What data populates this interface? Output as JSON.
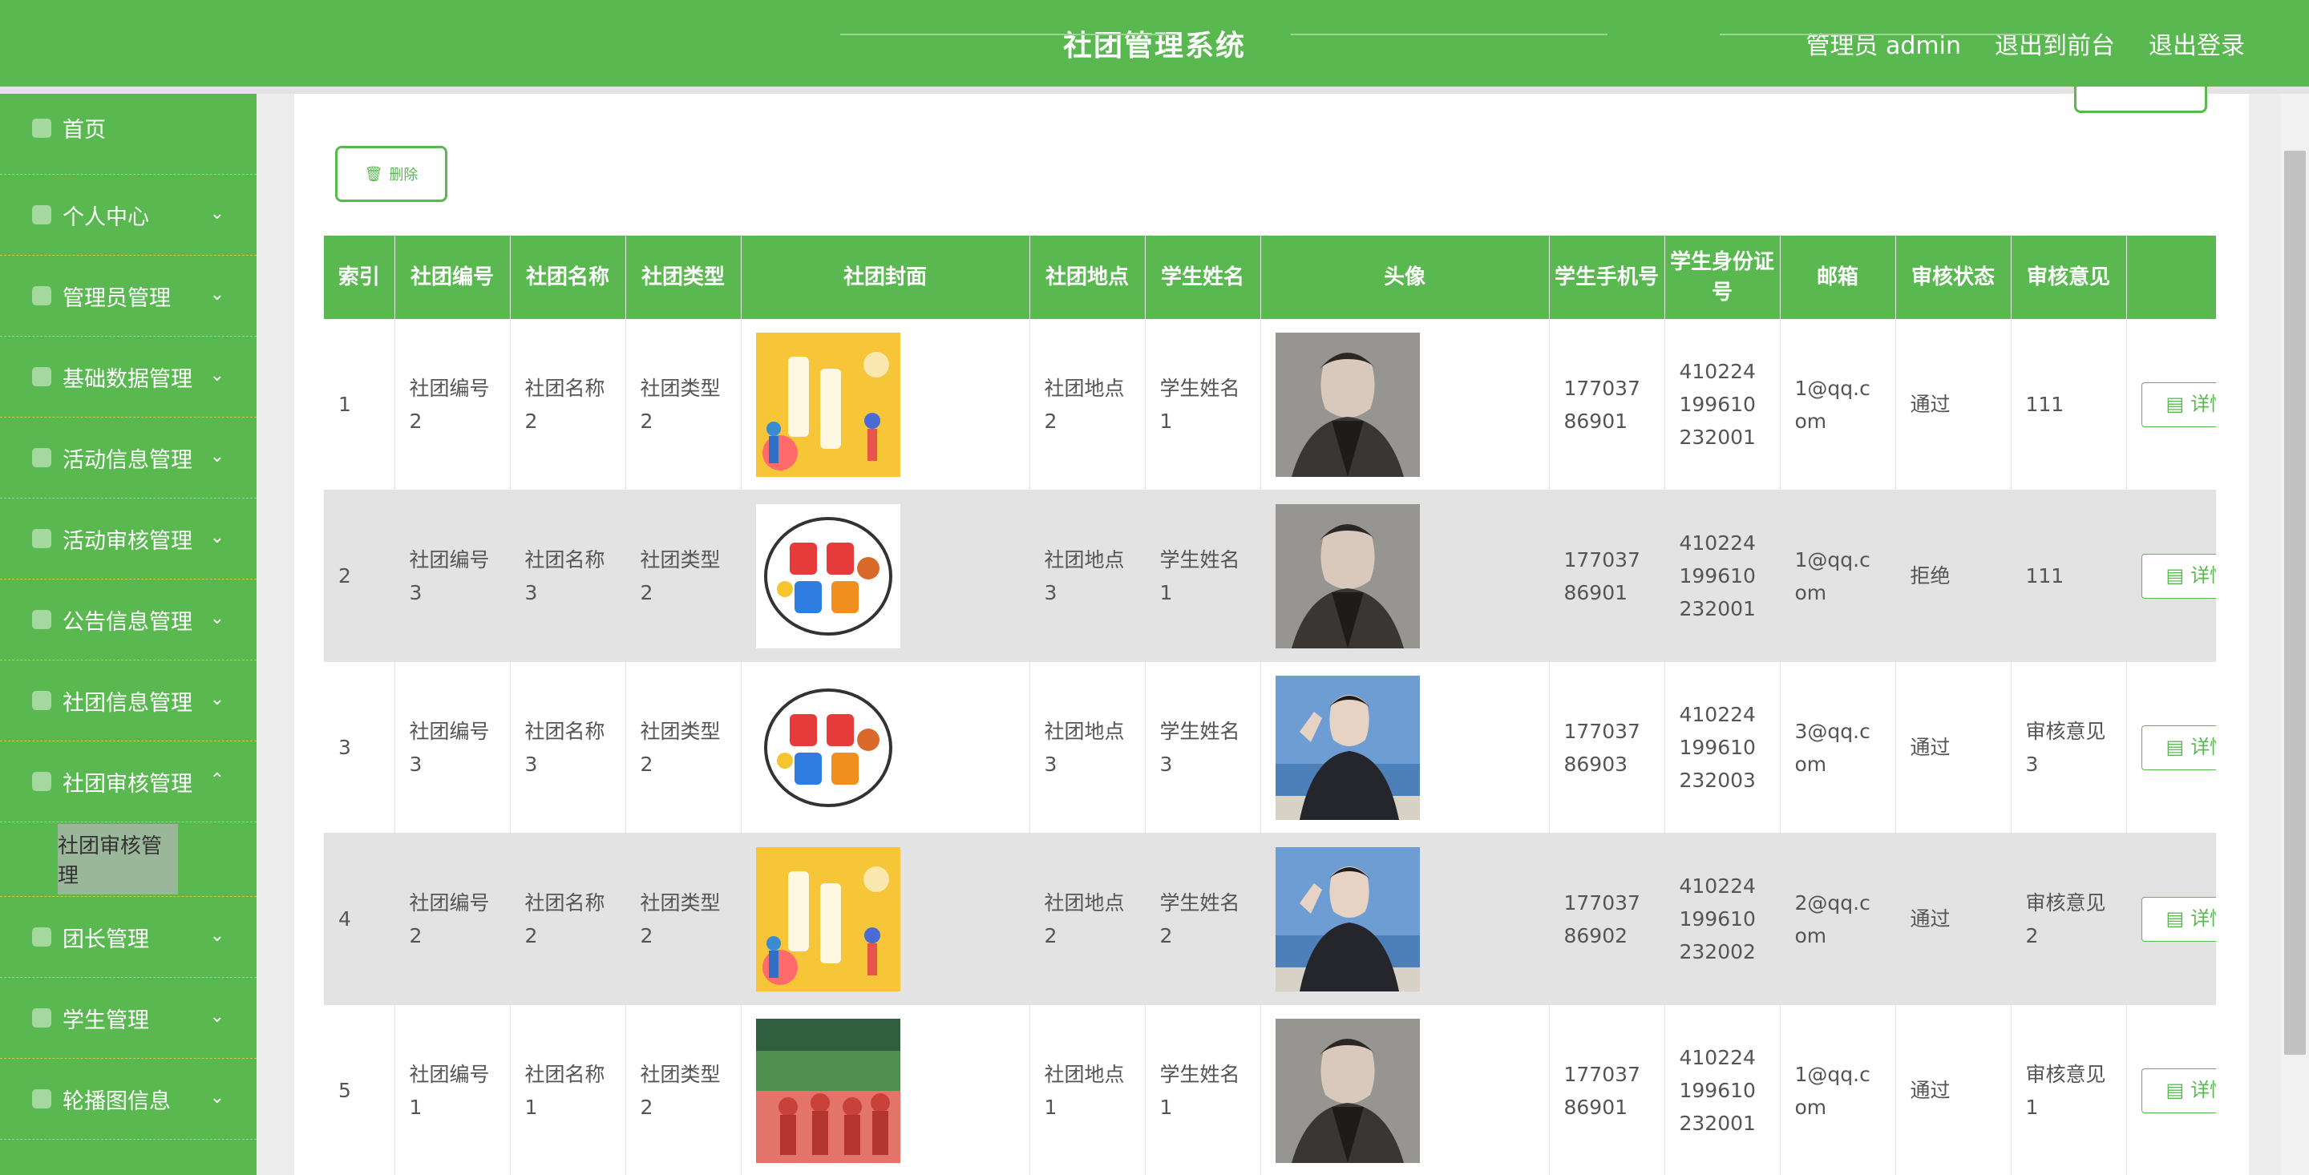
{
  "header": {
    "title": "社团管理系统",
    "user": "管理员 admin",
    "front_link": "退出到前台",
    "logout_link": "退出登录"
  },
  "sidebar": {
    "items": [
      {
        "label": "首页",
        "icon": "home-icon"
      },
      {
        "label": "个人中心",
        "icon": "user-icon",
        "expandable": true
      },
      {
        "label": "管理员管理",
        "icon": "admin-icon",
        "expandable": true
      },
      {
        "label": "基础数据管理",
        "icon": "database-icon",
        "expandable": true
      },
      {
        "label": "活动信息管理",
        "icon": "activity-icon",
        "expandable": true
      },
      {
        "label": "活动审核管理",
        "icon": "list-icon",
        "expandable": true
      },
      {
        "label": "公告信息管理",
        "icon": "notice-icon",
        "expandable": true
      },
      {
        "label": "社团信息管理",
        "icon": "clock-icon",
        "expandable": true
      },
      {
        "label": "社团审核管理",
        "icon": "chart-icon",
        "expandable": true,
        "expanded": true
      },
      {
        "label": "团长管理",
        "icon": "leader-icon",
        "expandable": true
      },
      {
        "label": "学生管理",
        "icon": "student-icon",
        "expandable": true
      },
      {
        "label": "轮播图信息",
        "icon": "carousel-icon",
        "expandable": true
      }
    ],
    "active_sub": "社团审核管理"
  },
  "toolbar": {
    "delete_label": "删除"
  },
  "table": {
    "headers": [
      "索引",
      "社团编号",
      "社团名称",
      "社团类型",
      "社团封面",
      "社团地点",
      "学生姓名",
      "头像",
      "学生手机号",
      "学生身份证号",
      "邮箱",
      "审核状态",
      "审核意见",
      ""
    ],
    "detail_label": "详情",
    "rows": [
      {
        "index": "1",
        "code": "社团编号2",
        "name": "社团名称2",
        "type": "社团类型2",
        "cover": "yellow-recruit",
        "place": "社团地点2",
        "student": "学生姓名1",
        "avatar": "avatar-a",
        "phone": "17703786901",
        "id_card": "410224199610232001",
        "email": "1@qq.com",
        "status": "通过",
        "opinion": "111"
      },
      {
        "index": "2",
        "code": "社团编号3",
        "name": "社团名称3",
        "type": "社团类型2",
        "cover": "bubble-recruit",
        "place": "社团地点3",
        "student": "学生姓名1",
        "avatar": "avatar-a",
        "phone": "17703786901",
        "id_card": "410224199610232001",
        "email": "1@qq.com",
        "status": "拒绝",
        "opinion": "111"
      },
      {
        "index": "3",
        "code": "社团编号3",
        "name": "社团名称3",
        "type": "社团类型2",
        "cover": "bubble-recruit",
        "place": "社团地点3",
        "student": "学生姓名3",
        "avatar": "avatar-b",
        "phone": "17703786903",
        "id_card": "410224199610232003",
        "email": "3@qq.com",
        "status": "通过",
        "opinion": "审核意见3"
      },
      {
        "index": "4",
        "code": "社团编号2",
        "name": "社团名称2",
        "type": "社团类型2",
        "cover": "yellow-recruit",
        "place": "社团地点2",
        "student": "学生姓名2",
        "avatar": "avatar-b",
        "phone": "17703786902",
        "id_card": "410224199610232002",
        "email": "2@qq.com",
        "status": "通过",
        "opinion": "审核意见2"
      },
      {
        "index": "5",
        "code": "社团编号1",
        "name": "社团名称1",
        "type": "社团类型2",
        "cover": "photo-recruit",
        "place": "社团地点1",
        "student": "学生姓名1",
        "avatar": "avatar-a",
        "phone": "17703786901",
        "id_card": "410224199610232001",
        "email": "1@qq.com",
        "status": "通过",
        "opinion": "审核意见1"
      }
    ]
  },
  "colors": {
    "accent": "#5ab850",
    "row_alt": "#e4e3e4",
    "sidebar_active": "#9bb79a"
  }
}
